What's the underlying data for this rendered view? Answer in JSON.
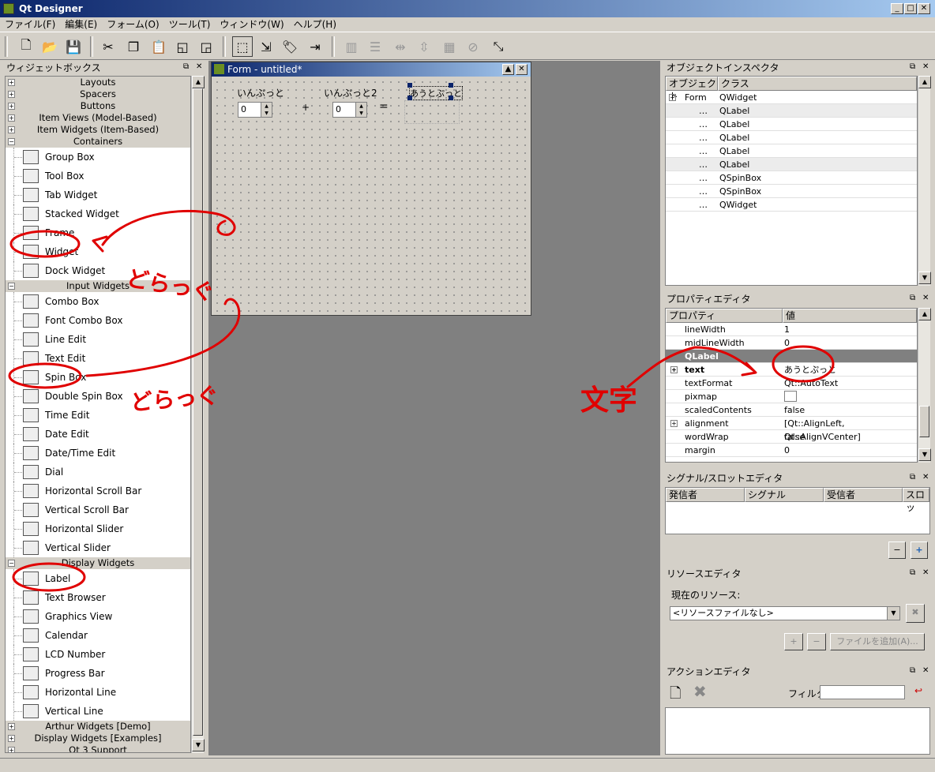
{
  "app": {
    "title": "Qt Designer"
  },
  "menu": [
    "ファイル(F)",
    "編集(E)",
    "フォーム(O)",
    "ツール(T)",
    "ウィンドウ(W)",
    "ヘルプ(H)"
  ],
  "widgetbox": {
    "title": "ウィジェットボックス",
    "top_categories": [
      "Layouts",
      "Spacers",
      "Buttons",
      "Item Views (Model-Based)",
      "Item Widgets (Item-Based)"
    ],
    "containers_label": "Containers",
    "containers": [
      "Group Box",
      "Tool Box",
      "Tab Widget",
      "Stacked Widget",
      "Frame",
      "Widget",
      "Dock Widget"
    ],
    "input_label": "Input Widgets",
    "inputs": [
      "Combo Box",
      "Font Combo Box",
      "Line Edit",
      "Text Edit",
      "Spin Box",
      "Double Spin Box",
      "Time Edit",
      "Date Edit",
      "Date/Time Edit",
      "Dial",
      "Horizontal Scroll Bar",
      "Vertical Scroll Bar",
      "Horizontal Slider",
      "Vertical Slider"
    ],
    "display_label": "Display Widgets",
    "displays": [
      "Label",
      "Text Browser",
      "Graphics View",
      "Calendar",
      "LCD Number",
      "Progress Bar",
      "Horizontal Line",
      "Vertical Line"
    ],
    "bottom_categories": [
      "Arthur Widgets [Demo]",
      "Display Widgets [Examples]",
      "Qt 3 Support"
    ]
  },
  "form": {
    "title": "Form - untitled*",
    "label1": "いんぷっと",
    "label2": "いんぷっと2",
    "label3": "あうとぷっと",
    "spin1": "0",
    "spin2": "0",
    "plus": "+",
    "equals": "="
  },
  "object_inspector": {
    "title": "オブジェクトインスペクタ",
    "col_object": "オブジェクト",
    "col_class": "クラス",
    "root_name": "Form",
    "root_class": "QWidget",
    "children": [
      "QLabel",
      "QLabel",
      "QLabel",
      "QLabel",
      "QLabel",
      "QSpinBox",
      "QSpinBox",
      "QWidget"
    ],
    "dots": "…"
  },
  "property_editor": {
    "title": "プロパティエディタ",
    "col_prop": "プロパティ",
    "col_value": "値",
    "rows": [
      {
        "name": "lineWidth",
        "value": "1"
      },
      {
        "name": "midLineWidth",
        "value": "0"
      },
      {
        "name": "QLabel",
        "value": ""
      },
      {
        "name": "text",
        "value": "あうとぷっと"
      },
      {
        "name": "textFormat",
        "value": "Qt::AutoText"
      },
      {
        "name": "pixmap",
        "value": ""
      },
      {
        "name": "scaledContents",
        "value": "false"
      },
      {
        "name": "alignment",
        "value": "[Qt::AlignLeft, Qt::AlignVCenter]"
      },
      {
        "name": "wordWrap",
        "value": "false"
      },
      {
        "name": "margin",
        "value": "0"
      }
    ]
  },
  "signal_slot": {
    "title": "シグナル/スロットエディタ",
    "cols": [
      "発信者",
      "シグナル",
      "受信者",
      "スロッ"
    ]
  },
  "resource_editor": {
    "title": "リソースエディタ",
    "current_label": "現在のリソース:",
    "combo_value": "<リソースファイルなし>",
    "add_file": "ファイルを追加(A)..."
  },
  "action_editor": {
    "title": "アクションエディタ",
    "filter_label": "フィルタ:",
    "filter_value": ""
  },
  "annotations": {
    "drag1": "どらっぐ",
    "drag2": "どらっぐ",
    "moji": "文字"
  }
}
